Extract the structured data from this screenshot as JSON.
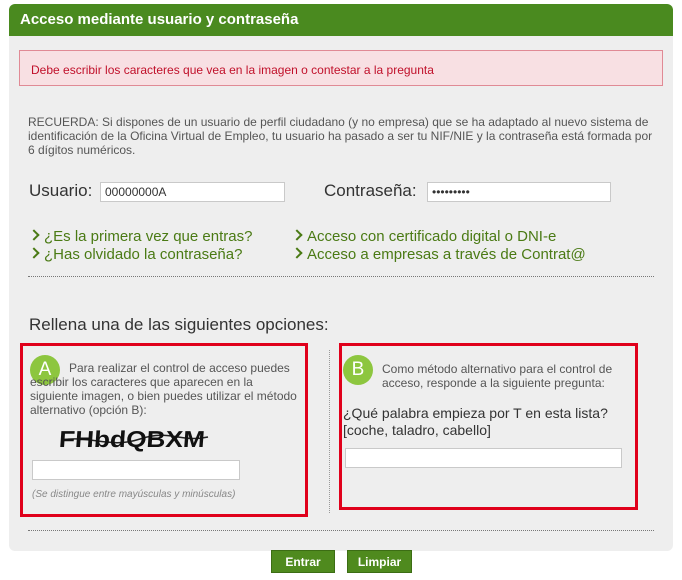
{
  "header": {
    "title": "Acceso mediante usuario y contraseña"
  },
  "error": {
    "message": "Debe escribir los caracteres que vea en la imagen o contestar a la pregunta"
  },
  "reminder": "RECUERDA: Si dispones de un usuario de perfil ciudadano (y no empresa) que se ha adaptado al nuevo sistema de identificación de la Oficina Virtual de Empleo, tu usuario ha pasado a ser tu NIF/NIE y la contraseña está formada por 6 dígitos numéricos.",
  "login": {
    "user_label": "Usuario:",
    "user_value": "00000000A",
    "password_label": "Contraseña:",
    "password_value": "•••••••••"
  },
  "links": {
    "first_time": "¿Es la primera vez que entras?",
    "forgot_password": "¿Has olvidado la contraseña?",
    "digital_certificate": "Acceso con certificado digital o DNI-e",
    "companies_contrata": "Acceso a empresas a través de Contrat@"
  },
  "options": {
    "title": "Rellena una de las siguientes opciones:",
    "a": {
      "badge": "A",
      "text_line1": "Para realizar el control de acceso puedes",
      "text_rest": "escribir los caracteres que aparecen en la siguiente imagen, o bien puedes utilizar el método alternativo (opción B):",
      "captcha_text": "FHbdQBXM",
      "input_value": "",
      "hint": "(Se distingue entre mayúsculas y minúsculas)"
    },
    "b": {
      "badge": "B",
      "text": "Como método alternativo para el control de acceso, responde a la siguiente pregunta:",
      "question_line1": "¿Qué palabra empieza por T en esta lista?",
      "question_line2": "[coche, taladro, cabello]",
      "input_value": ""
    }
  },
  "buttons": {
    "enter": "Entrar",
    "clear": "Limpiar"
  },
  "colors": {
    "header_green": "#4a8a1f",
    "badge_green": "#8dc63f",
    "highlight_red": "#e0001b",
    "error_text": "#c0102a"
  },
  "icons": {
    "link_arrow": "chevron-right-icon"
  }
}
